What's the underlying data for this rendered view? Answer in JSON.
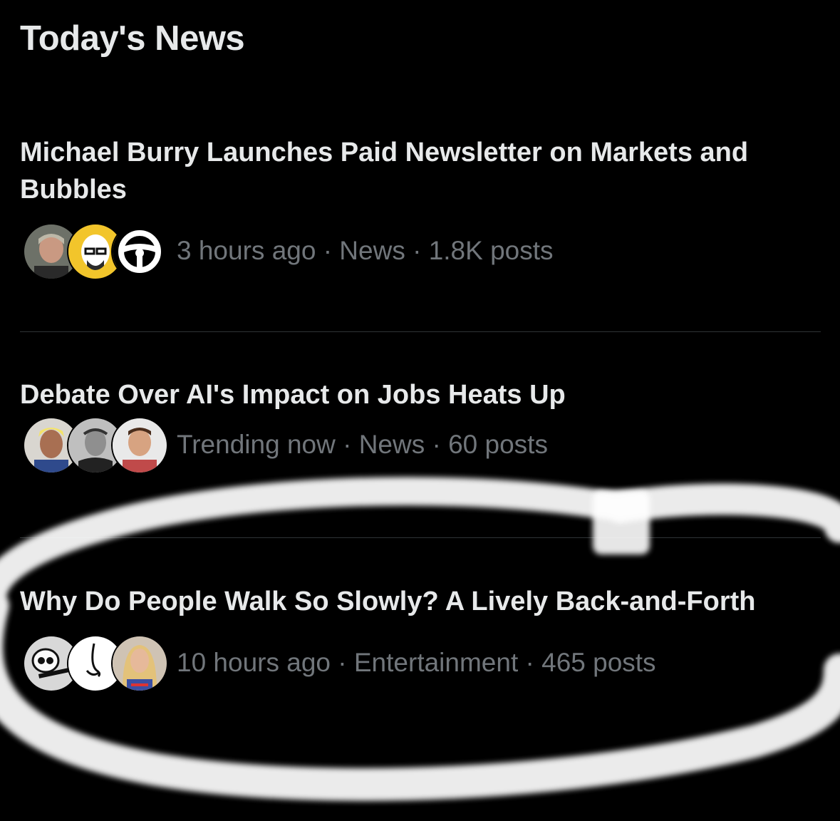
{
  "section": {
    "title": "Today's News"
  },
  "items": [
    {
      "headline": "Michael Burry Launches Paid Newsletter on Markets and Bubbles",
      "meta": "3 hours ago · News · 1.8K posts",
      "avatars": [
        "man-portrait-avatar",
        "cartoon-bald-man-avatar",
        "steering-wheel-avatar"
      ]
    },
    {
      "headline": "Debate Over AI's Impact on Jobs Heats Up",
      "meta": "Trending now · News · 60 posts",
      "avatars": [
        "cartoon-blond-man-avatar",
        "shakespeare-portrait-avatar",
        "smiling-man-avatar"
      ]
    },
    {
      "headline": "Why Do People Walk So Slowly? A Lively Back-and-Forth",
      "meta": "10 hours ago · Entertainment · 465 posts",
      "avatars": [
        "skull-avatar",
        "nose-drawing-avatar",
        "blonde-woman-avatar"
      ]
    }
  ],
  "colors": {
    "background": "#000000",
    "headline": "#e7e9ea",
    "meta": "#71767b",
    "divider": "#2f3336",
    "scribble": "#ffffff"
  }
}
